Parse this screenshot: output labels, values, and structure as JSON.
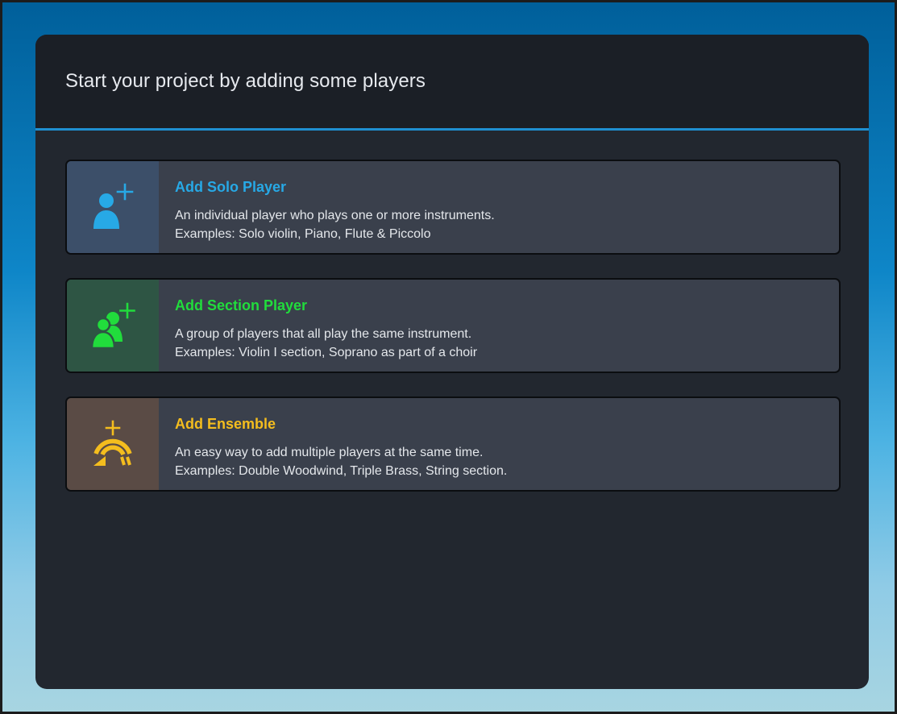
{
  "dialog": {
    "title": "Start your project by adding some players"
  },
  "colors": {
    "solo_accent": "#27a9e6",
    "section_accent": "#21dc3c",
    "ensemble_accent": "#f4bd1e",
    "header_divider": "#1f8fd0"
  },
  "options": [
    {
      "id": "solo",
      "icon": "add-solo-player-icon",
      "title": "Add Solo Player",
      "description": "An individual player who plays one or more instruments.",
      "examples": "Examples: Solo violin, Piano, Flute & Piccolo"
    },
    {
      "id": "section",
      "icon": "add-section-player-icon",
      "title": "Add Section Player",
      "description": "A group of players that all play the same instrument.",
      "examples": "Examples: Violin I section, Soprano as part of a choir"
    },
    {
      "id": "ensemble",
      "icon": "add-ensemble-icon",
      "title": "Add Ensemble",
      "description": "An easy way to add multiple players at the same time.",
      "examples": "Examples: Double Woodwind, Triple Brass, String section."
    }
  ]
}
